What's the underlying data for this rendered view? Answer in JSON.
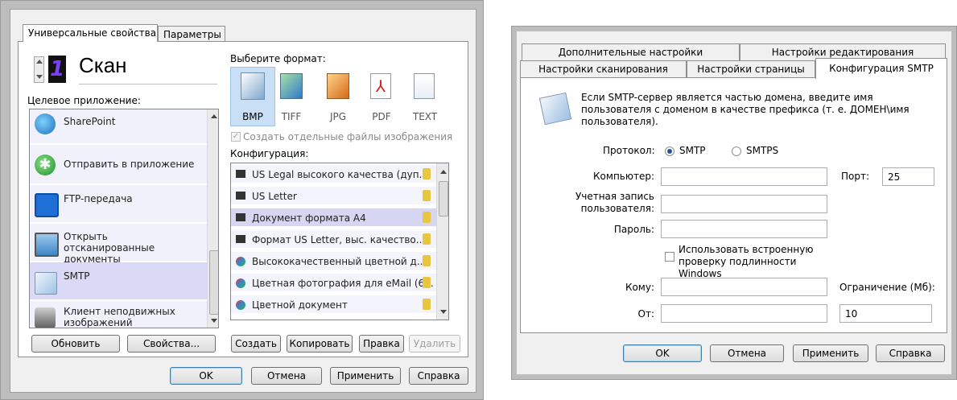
{
  "left": {
    "tabs": [
      "Универсальные свойства",
      "Параметры"
    ],
    "profile": {
      "number": "1",
      "name": "Скан"
    },
    "dest_label": "Целевое приложение:",
    "apps": [
      {
        "label": "SharePoint",
        "icon": "sharepoint-icon"
      },
      {
        "label": "Отправить в приложение",
        "icon": "send-to-app-icon"
      },
      {
        "label": "FTP-передача",
        "icon": "ftp-icon"
      },
      {
        "label": "Открыть отсканированные документы",
        "icon": "open-docs-icon"
      },
      {
        "label": "SMTP",
        "icon": "envelope-icon",
        "selected": true
      },
      {
        "label": "Клиент неподвижных изображений",
        "icon": "camera-icon"
      }
    ],
    "format_label": "Выберите формат:",
    "formats": [
      "BMP",
      "TIFF",
      "JPG",
      "PDF",
      "TEXT"
    ],
    "selected_format": "BMP",
    "separate_files": "Создать отдельные файлы изображения",
    "config_label": "Конфигурация:",
    "configs": [
      "US Legal высокого качества (дуп...",
      "US Letter",
      "Документ формата A4",
      "Формат US Letter, выс. качество...",
      "Высококачественный цветной д...",
      "Цветная фотография для eMail (6...",
      "Цветной документ"
    ],
    "selected_config_index": 2,
    "buttons": {
      "refresh": "Обновить",
      "properties": "Свойства...",
      "create": "Создать",
      "copy": "Копировать",
      "edit": "Правка",
      "delete": "Удалить",
      "ok": "OK",
      "cancel": "Отмена",
      "apply": "Применить",
      "help": "Справка"
    }
  },
  "right": {
    "tabs_row1": [
      "Дополнительные настройки",
      "Настройки редактирования"
    ],
    "tabs_row2": [
      "Настройки сканирования",
      "Настройки страницы",
      "Конфигурация SMTP"
    ],
    "info": "Если SMTP-сервер является частью домена, введите имя пользователя с доменом в качестве префикса (т. е. ДОМЕН\\имя пользователя).",
    "protocol_label": "Протокол:",
    "protocol_options": [
      "SMTP",
      "SMTPS"
    ],
    "protocol_selected": "SMTP",
    "computer_label": "Компьютер:",
    "computer_value": "",
    "port_label": "Порт:",
    "port_value": "25",
    "account_label": "Учетная запись пользователя:",
    "account_value": "",
    "password_label": "Пароль:",
    "password_value": "",
    "windows_auth_label": "Использовать встроенную проверку подлинности Windows",
    "windows_auth_checked": false,
    "to_label": "Кому:",
    "to_value": "",
    "limit_label": "Ограничение (Мб):",
    "limit_value": "10",
    "from_label": "От:",
    "from_value": "",
    "buttons": {
      "ok": "OK",
      "cancel": "Отмена",
      "apply": "Применить",
      "help": "Справка"
    }
  }
}
